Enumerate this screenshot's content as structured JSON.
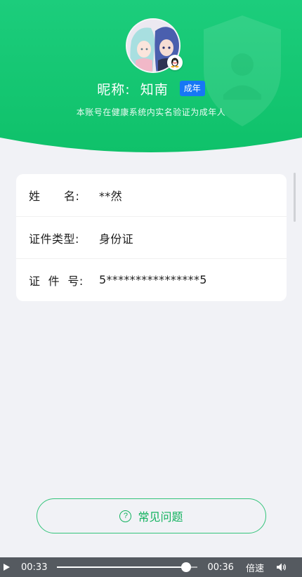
{
  "header": {
    "nickname_label": "昵称:",
    "nickname_value": "知南",
    "age_badge": "成年",
    "verify_text": "本账号在健康系统内实名验证为成年人",
    "avatar_icon": "anime-avatar",
    "badge_icon": "qq-penguin-icon",
    "colors": {
      "green_top": "#1fcf7f",
      "green_bottom": "#10c06a",
      "badge_blue": "#1677f5"
    }
  },
  "info": [
    {
      "label": "姓      名:",
      "value": "**然"
    },
    {
      "label": "证件类型:",
      "value": "身份证"
    },
    {
      "label": "证  件  号:",
      "value": "5****************5"
    }
  ],
  "faq": {
    "icon": "question-circle-icon",
    "label": "常见问题"
  },
  "player": {
    "current_time": "00:33",
    "total_time": "00:36",
    "speed_label": "倍速",
    "progress": 0.9167
  }
}
